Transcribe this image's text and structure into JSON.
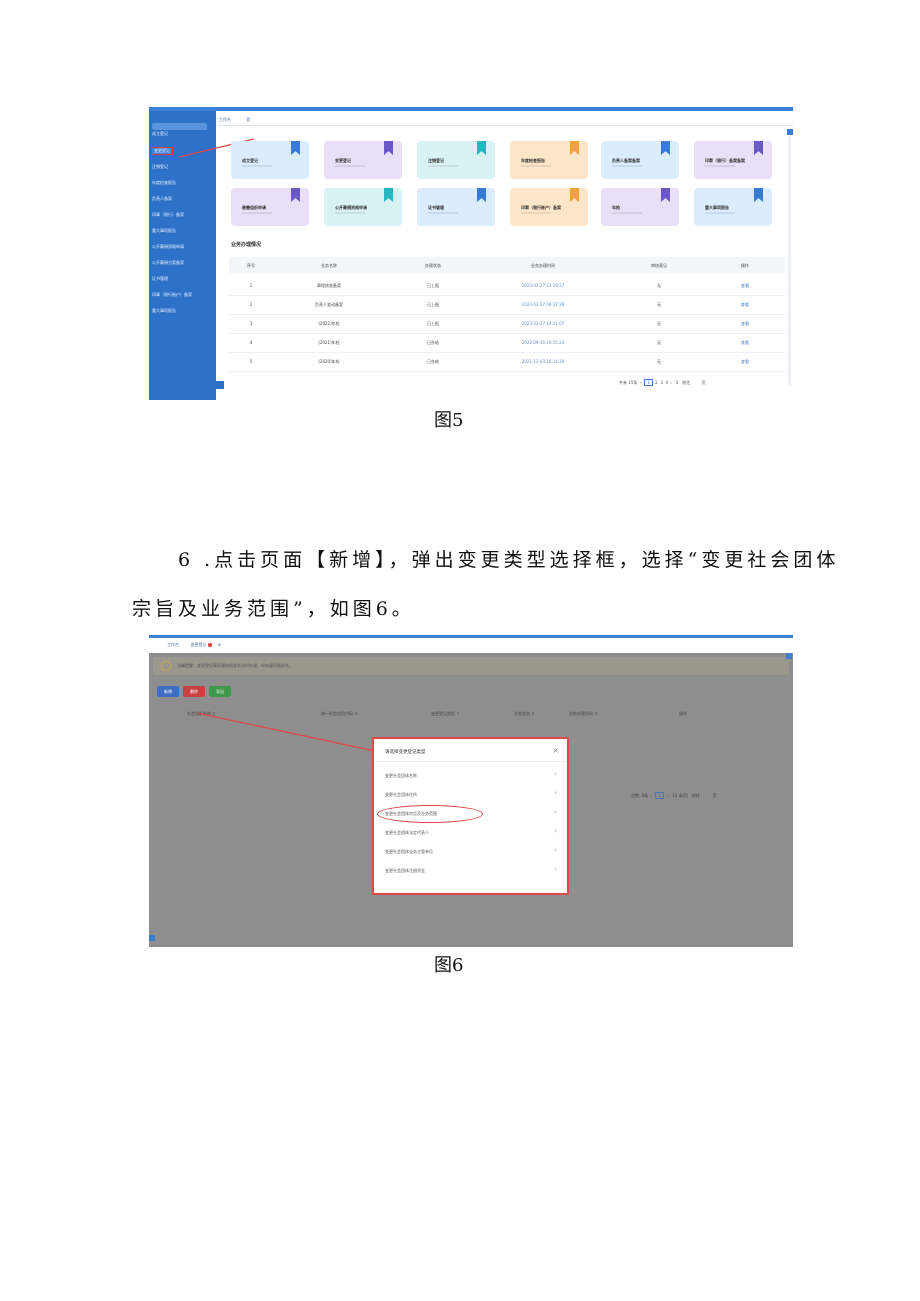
{
  "figure5": {
    "caption": "图5",
    "tabs": [
      "工作台",
      "首"
    ],
    "sidebar": [
      "成立登记",
      "变更登记",
      "注销登记",
      "年度检查报告",
      "负责人备案",
      "印章（银行）备案",
      "重大事项报告",
      "公开募捐资格申请",
      "公开募捐方案备案",
      "证书管理",
      "印章（银行账户）备案",
      "重大事项报告"
    ],
    "cards_row1": [
      {
        "label": "成立登记",
        "bg": "#dcecff",
        "ribbon": "#3a7bd5"
      },
      {
        "label": "变更登记",
        "bg": "#eadff8",
        "ribbon": "#6a58c8"
      },
      {
        "label": "注销登记",
        "bg": "#d9f3f4",
        "ribbon": "#2bb4c2"
      },
      {
        "label": "年度检查报告",
        "bg": "#ffe6c9",
        "ribbon": "#f1a33a"
      },
      {
        "label": "负责人备案备案",
        "bg": "#dcecff",
        "ribbon": "#3a7bd5"
      },
      {
        "label": "印章（银行）备案备案",
        "bg": "#eadff8",
        "ribbon": "#6a58c8"
      }
    ],
    "cards_row2": [
      {
        "label": "慈善组织申请",
        "bg": "#eadff8",
        "ribbon": "#6a58c8"
      },
      {
        "label": "公开募捐资格申请",
        "bg": "#d9f3f4",
        "ribbon": "#2bb4c2"
      },
      {
        "label": "证书管理",
        "bg": "#dcecff",
        "ribbon": "#3a7bd5"
      },
      {
        "label": "印章（银行账户）备案",
        "bg": "#ffe6c9",
        "ribbon": "#f1a33a"
      },
      {
        "label": "年检",
        "bg": "#eadff8",
        "ribbon": "#6a58c8"
      },
      {
        "label": "重大事项报告",
        "bg": "#dcecff",
        "ribbon": "#3a7bd5"
      }
    ],
    "section_title": "业务办理情况",
    "table_headers": [
      "序号",
      "业务名称",
      "办理状态",
      "业务办理时间",
      "审核意见",
      "操作"
    ],
    "table_rows": [
      [
        "1",
        "章程核准备案",
        "已上报",
        "2023-03-27 13:29:27",
        "无",
        "查看"
      ],
      [
        "2",
        "负责人变动备案",
        "已上报",
        "2023-03-27 09:17:39",
        "无",
        "查看"
      ],
      [
        "3",
        "(2022)年检",
        "已上报",
        "2023-03-27 14:11:07",
        "无",
        "查看"
      ],
      [
        "4",
        "(2021)年检",
        "已办结",
        "2022-09-30 19:15:24",
        "无",
        "查看"
      ],
      [
        "5",
        "(2020)年检",
        "已办结",
        "2021-12-03 16:14:39",
        "无",
        "查看"
      ]
    ],
    "pager": {
      "total": "共有 15条",
      "pages": [
        "1",
        "2",
        "3",
        "4"
      ],
      "next": "5",
      "goto": "前往",
      "unit": "页"
    }
  },
  "paragraph": {
    "line1": "6 .点击页面【新增】，弹出变更类型选择框，选择“变更社会团体",
    "line2": "宗旨及业务范围”，如图6。"
  },
  "figure6": {
    "caption": "图6",
    "tabs": {
      "first": "工作台",
      "second": "变更登记",
      "close": "⊗"
    },
    "notice": "温馨提醒：变更登记事项请按照要求及时办理，如有疑问请联系。",
    "buttons": [
      {
        "label": "新增",
        "color": "#3f6fc4"
      },
      {
        "label": "删除",
        "color": "#c94040"
      },
      {
        "label": "导出",
        "color": "#3f9a4c"
      }
    ],
    "table_headers": [
      "社会组织名称 ↕",
      "统一社会信用代码 ↕",
      "变更登记类型 ↕",
      "业务状态 ↕",
      "业务办理时间 ↕",
      "操作"
    ],
    "pager": {
      "total": "总数: 0条",
      "page": "1",
      "per_page": "10 条/页",
      "goto": "前往",
      "unit": "页"
    },
    "dialog": {
      "title": "请选择变更登记类型",
      "close": "×",
      "options": [
        "变更社会团体名称",
        "变更社会团体住所",
        "变更社会团体宗旨及业务范围",
        "变更社会团体法定代表人",
        "变更社会团体业务主管单位",
        "变更社会团体注册资金"
      ]
    }
  }
}
